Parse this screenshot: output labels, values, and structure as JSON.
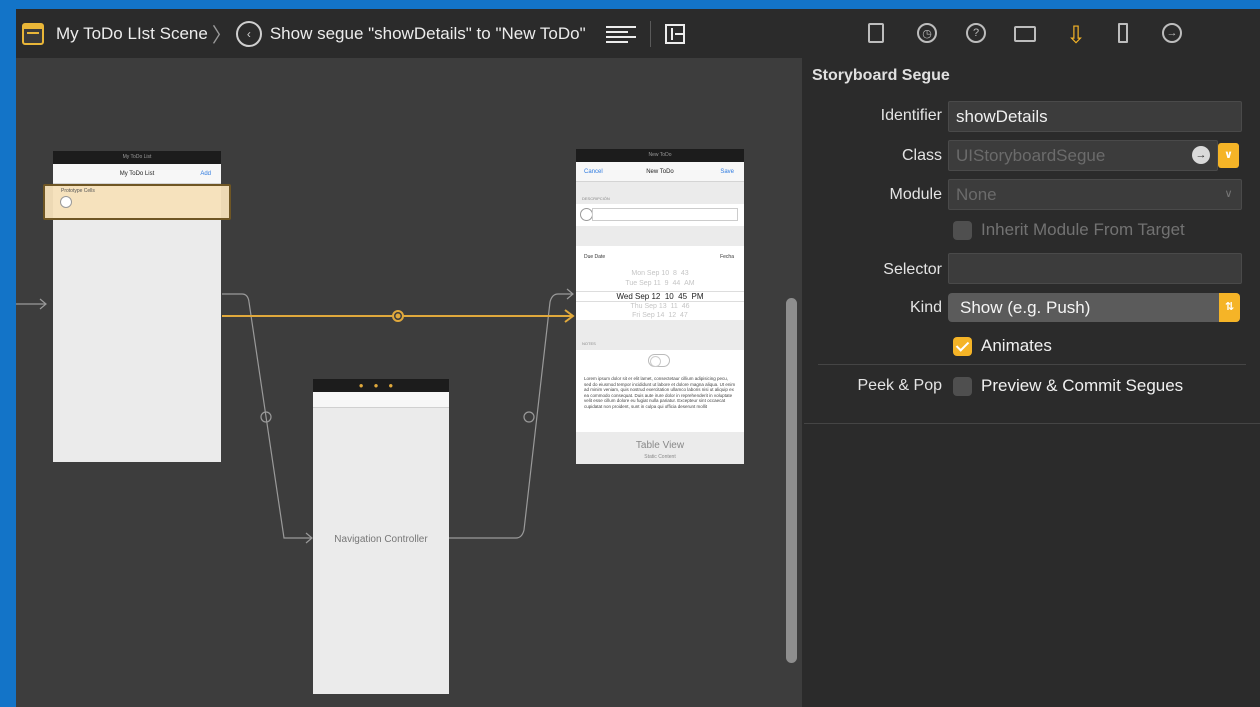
{
  "jumpbar": {
    "scene": "My ToDo LIst Scene",
    "separator": "〉",
    "segue": "Show segue \"showDetails\" to \"New ToDo\""
  },
  "canvas": {
    "list_scene": {
      "dock": "My ToDo List",
      "title": "My ToDo List",
      "add": "Add",
      "cell": "Prototype Cells"
    },
    "nav_controller": {
      "label": "Navigation Controller"
    },
    "new_todo": {
      "dock": "New ToDo",
      "cancel": "Cancel",
      "title": "New ToDo",
      "save": "Save",
      "section_1": "DESCRIPCIÓN",
      "due_label": "Due Date",
      "due_right": "Fecha",
      "picker_rows": [
        [
          "Mon Sep 10",
          "8",
          "43",
          ""
        ],
        [
          "Tue Sep 11",
          "9",
          "44",
          "AM"
        ],
        [
          "Wed Sep 12",
          "10",
          "45",
          "PM"
        ],
        [
          "Thu Sep 13",
          "11",
          "46",
          ""
        ],
        [
          "Fri Sep 14",
          "12",
          "47",
          ""
        ]
      ],
      "section_2": "NOTES",
      "lorem": "Lorem ipsum dolor sit er elit lamet, consectetaur cillium adipisicing pecu, sed do eiusmod tempor incididunt ut labore et dolore magna aliqua. Ut enim ad minim veniam, quis nostrud exercitation ullamco laboris nisi ut aliquip ex ea commodo consequat. Duis aute irure dolor in reprehenderit in voluptate velit esse cillum dolore eu fugiat nulla pariatur. Excepteur sint occaecat cupidatat non proident, sunt in culpa qui officia deserunt mollit",
      "table_view": "Table View",
      "static_content": "Static Content"
    }
  },
  "inspector": {
    "title": "Storyboard Segue",
    "identifier": {
      "label": "Identifier",
      "value": "showDetails"
    },
    "class": {
      "label": "Class",
      "value": "UIStoryboardSegue"
    },
    "module": {
      "label": "Module",
      "value": "None"
    },
    "inherit": {
      "label": "Inherit Module From Target",
      "checked": false
    },
    "selector": {
      "label": "Selector",
      "value": ""
    },
    "kind": {
      "label": "Kind",
      "value": "Show (e.g. Push)"
    },
    "animates": {
      "label": "Animates",
      "checked": true
    },
    "peek": {
      "label": "Peek & Pop",
      "option": "Preview & Commit Segues",
      "checked": false
    }
  },
  "colors": {
    "accent": "#f5b427",
    "segue_line": "#e1a93c",
    "desktop": "#1374c8"
  }
}
